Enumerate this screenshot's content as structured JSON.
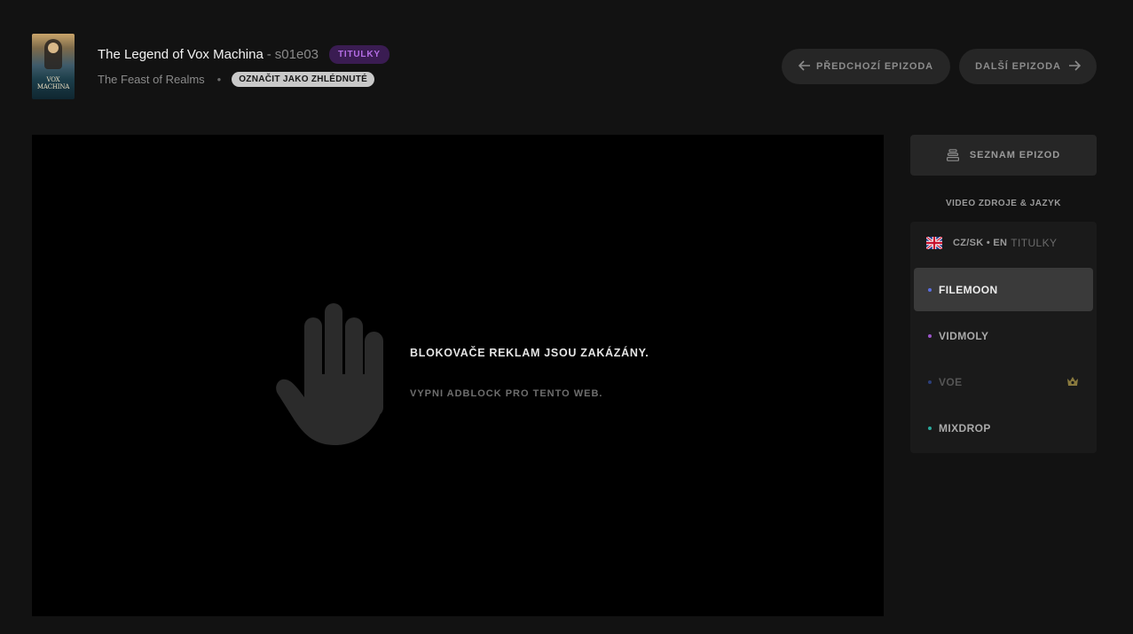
{
  "episode": {
    "show_title": "The Legend of Vox Machina",
    "separator": "-",
    "code": "s01e03",
    "badge": "TITULKY",
    "episode_title": "The Feast of Realms",
    "dot": "•",
    "mark_watched": "OZNAČIT JAKO ZHLÉDNUTÉ",
    "poster_text": "VOX MACHINA"
  },
  "nav": {
    "prev_label": "PŘEDCHOZÍ EPIZODA",
    "next_label": "DALŠÍ EPIZODA",
    "prev_icon": "arrow-left-icon",
    "next_icon": "arrow-right-icon"
  },
  "player": {
    "block_title": "BLOKOVAČE REKLAM JSOU ZAKÁZÁNY.",
    "block_subtitle": "VYPNI ADBLOCK PRO TENTO WEB.",
    "icon": "hand-stop-icon"
  },
  "sidebar": {
    "episode_list_label": "SEZNAM EPIZOD",
    "sources_heading": "VIDEO ZDROJE & JAZYK",
    "language": {
      "flag": "uk-flag-icon",
      "label": "CZ/SK • EN",
      "sub": "TITULKY"
    },
    "sources": [
      {
        "label": "FILEMOON",
        "color": "#5b6ee0",
        "active": true
      },
      {
        "label": "VIDMOLY",
        "color": "#9b55c9",
        "active": false
      },
      {
        "label": "VOE",
        "color": "#2c3f7a",
        "active": false,
        "premium_icon": "crown-icon"
      },
      {
        "label": "MIXDROP",
        "color": "#2aa89c",
        "active": false
      }
    ]
  },
  "colors": {
    "background": "#121212",
    "panel": "#1a1a1a",
    "button": "#262626",
    "badge_purple": "#b56ee6",
    "crown_gold": "#8a7a3e"
  }
}
